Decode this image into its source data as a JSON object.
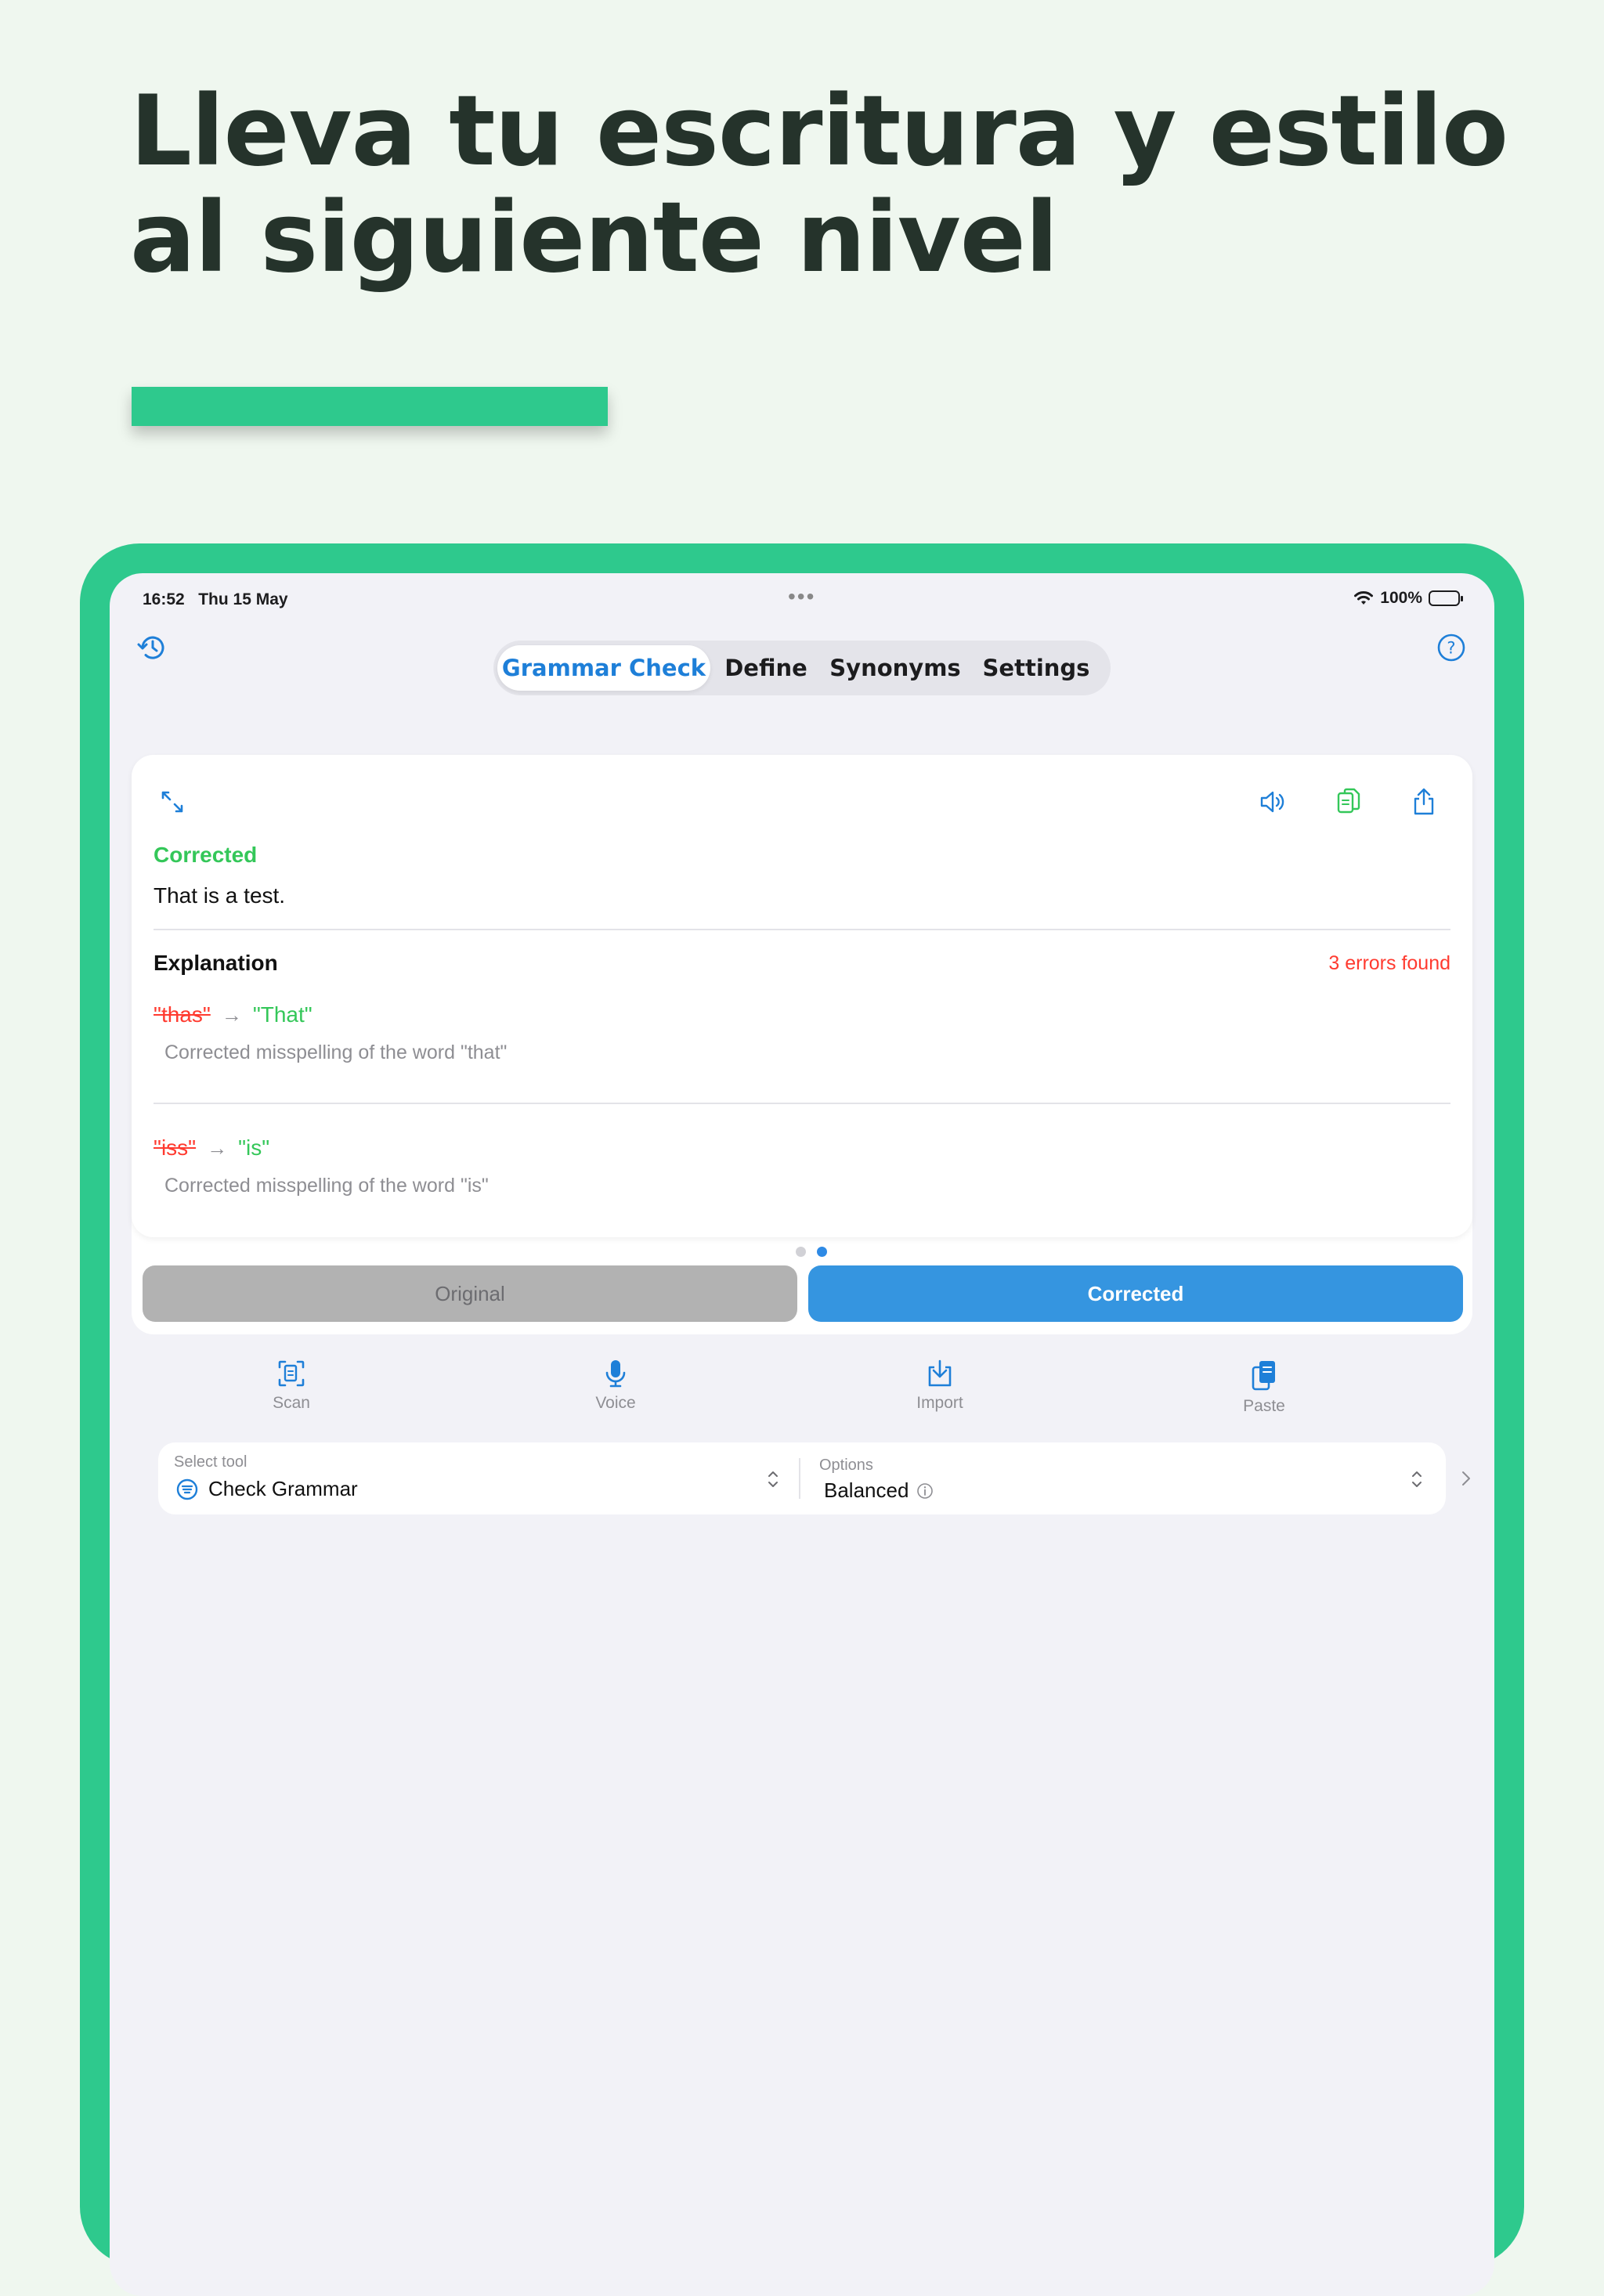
{
  "hero": {
    "line1": "Lleva tu escritura y estilo",
    "line2": "al siguiente nivel"
  },
  "status_bar": {
    "time": "16:52",
    "date": "Thu 15 May",
    "battery": "100%"
  },
  "nav": {
    "tabs": [
      {
        "label": "Grammar Check",
        "active": true
      },
      {
        "label": "Define",
        "active": false
      },
      {
        "label": "Synonyms",
        "active": false
      },
      {
        "label": "Settings",
        "active": false
      }
    ]
  },
  "result": {
    "corrected_label": "Corrected",
    "corrected_text": "That is a test.",
    "explanation_title": "Explanation",
    "errors_found": "3 errors found",
    "changes": [
      {
        "old": "\"thas\"",
        "new": "\"That\"",
        "description": "Corrected misspelling of the word \"that\""
      },
      {
        "old": "\"iss\"",
        "new": "\"is\"",
        "description": "Corrected misspelling of the word \"is\""
      }
    ],
    "pager_active": 2,
    "pager_total": 2
  },
  "mode_toggle": {
    "original": "Original",
    "corrected": "Corrected"
  },
  "actions": {
    "scan": "Scan",
    "voice": "Voice",
    "import": "Import",
    "paste": "Paste"
  },
  "tool_selector": {
    "tool_caption": "Select tool",
    "tool_value": "Check Grammar",
    "options_caption": "Options",
    "options_value": "Balanced"
  },
  "colors": {
    "accent_green": "#2ec98d",
    "brand_blue": "#1e7fd8",
    "error_red": "#ff3b30",
    "success_green": "#34c759"
  }
}
